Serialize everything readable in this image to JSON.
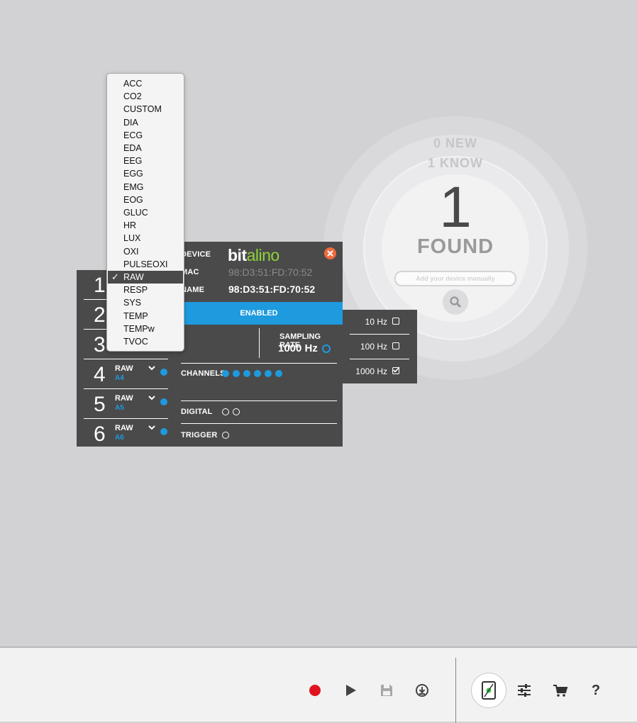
{
  "found_graphic": {
    "new_label": "0 NEW",
    "known_label": "1 KNOW",
    "count": "1",
    "found_label": "FOUND",
    "manual_placeholder": "Add your device manually"
  },
  "channels": [
    {
      "num": "1",
      "type": "",
      "port": ""
    },
    {
      "num": "2",
      "type": "",
      "port": ""
    },
    {
      "num": "3",
      "type": "",
      "port": ""
    },
    {
      "num": "4",
      "type": "RAW",
      "port": "A4"
    },
    {
      "num": "5",
      "type": "RAW",
      "port": "A5"
    },
    {
      "num": "6",
      "type": "RAW",
      "port": "A6"
    }
  ],
  "device": {
    "device_label": "DEVICE",
    "logo_bit": "bit",
    "logo_alino": "alino",
    "mac_label": "MAC",
    "mac_value": "98:D3:51:FD:70:52",
    "name_label": "NAME",
    "name_value": "98:D3:51:FD:70:52",
    "status": "ENABLED",
    "sampling_rate_label": "SAMPLING RATE",
    "sampling_rate_value": "1000 Hz",
    "channels_label": "CHANNELS",
    "digital_label": "DIGITAL",
    "trigger_label": "TRIGGER"
  },
  "sampling_options": [
    {
      "label": "10 Hz",
      "checked": false
    },
    {
      "label": "100 Hz",
      "checked": false
    },
    {
      "label": "1000 Hz",
      "checked": true
    }
  ],
  "type_menu": {
    "items": [
      "ACC",
      "CO2",
      "CUSTOM",
      "DIA",
      "ECG",
      "EDA",
      "EEG",
      "EGG",
      "EMG",
      "EOG",
      "GLUC",
      "HR",
      "LUX",
      "OXI",
      "PULSEOXI",
      "RAW",
      "RESP",
      "SYS",
      "TEMP",
      "TEMPw",
      "TVOC"
    ],
    "selected": "RAW",
    "check_glyph": "✓"
  },
  "toolbar": {
    "record": "record-icon",
    "play": "play-icon",
    "save": "save-icon",
    "download": "download-icon",
    "device": "device-icon",
    "settings": "settings-icon",
    "cart": "cart-icon",
    "help": "?"
  },
  "colors": {
    "accent": "#1e9ade",
    "panel": "#4a4a4a",
    "record": "#e0141e",
    "close": "#ef6b3e",
    "logo_green": "#8fd33a"
  }
}
